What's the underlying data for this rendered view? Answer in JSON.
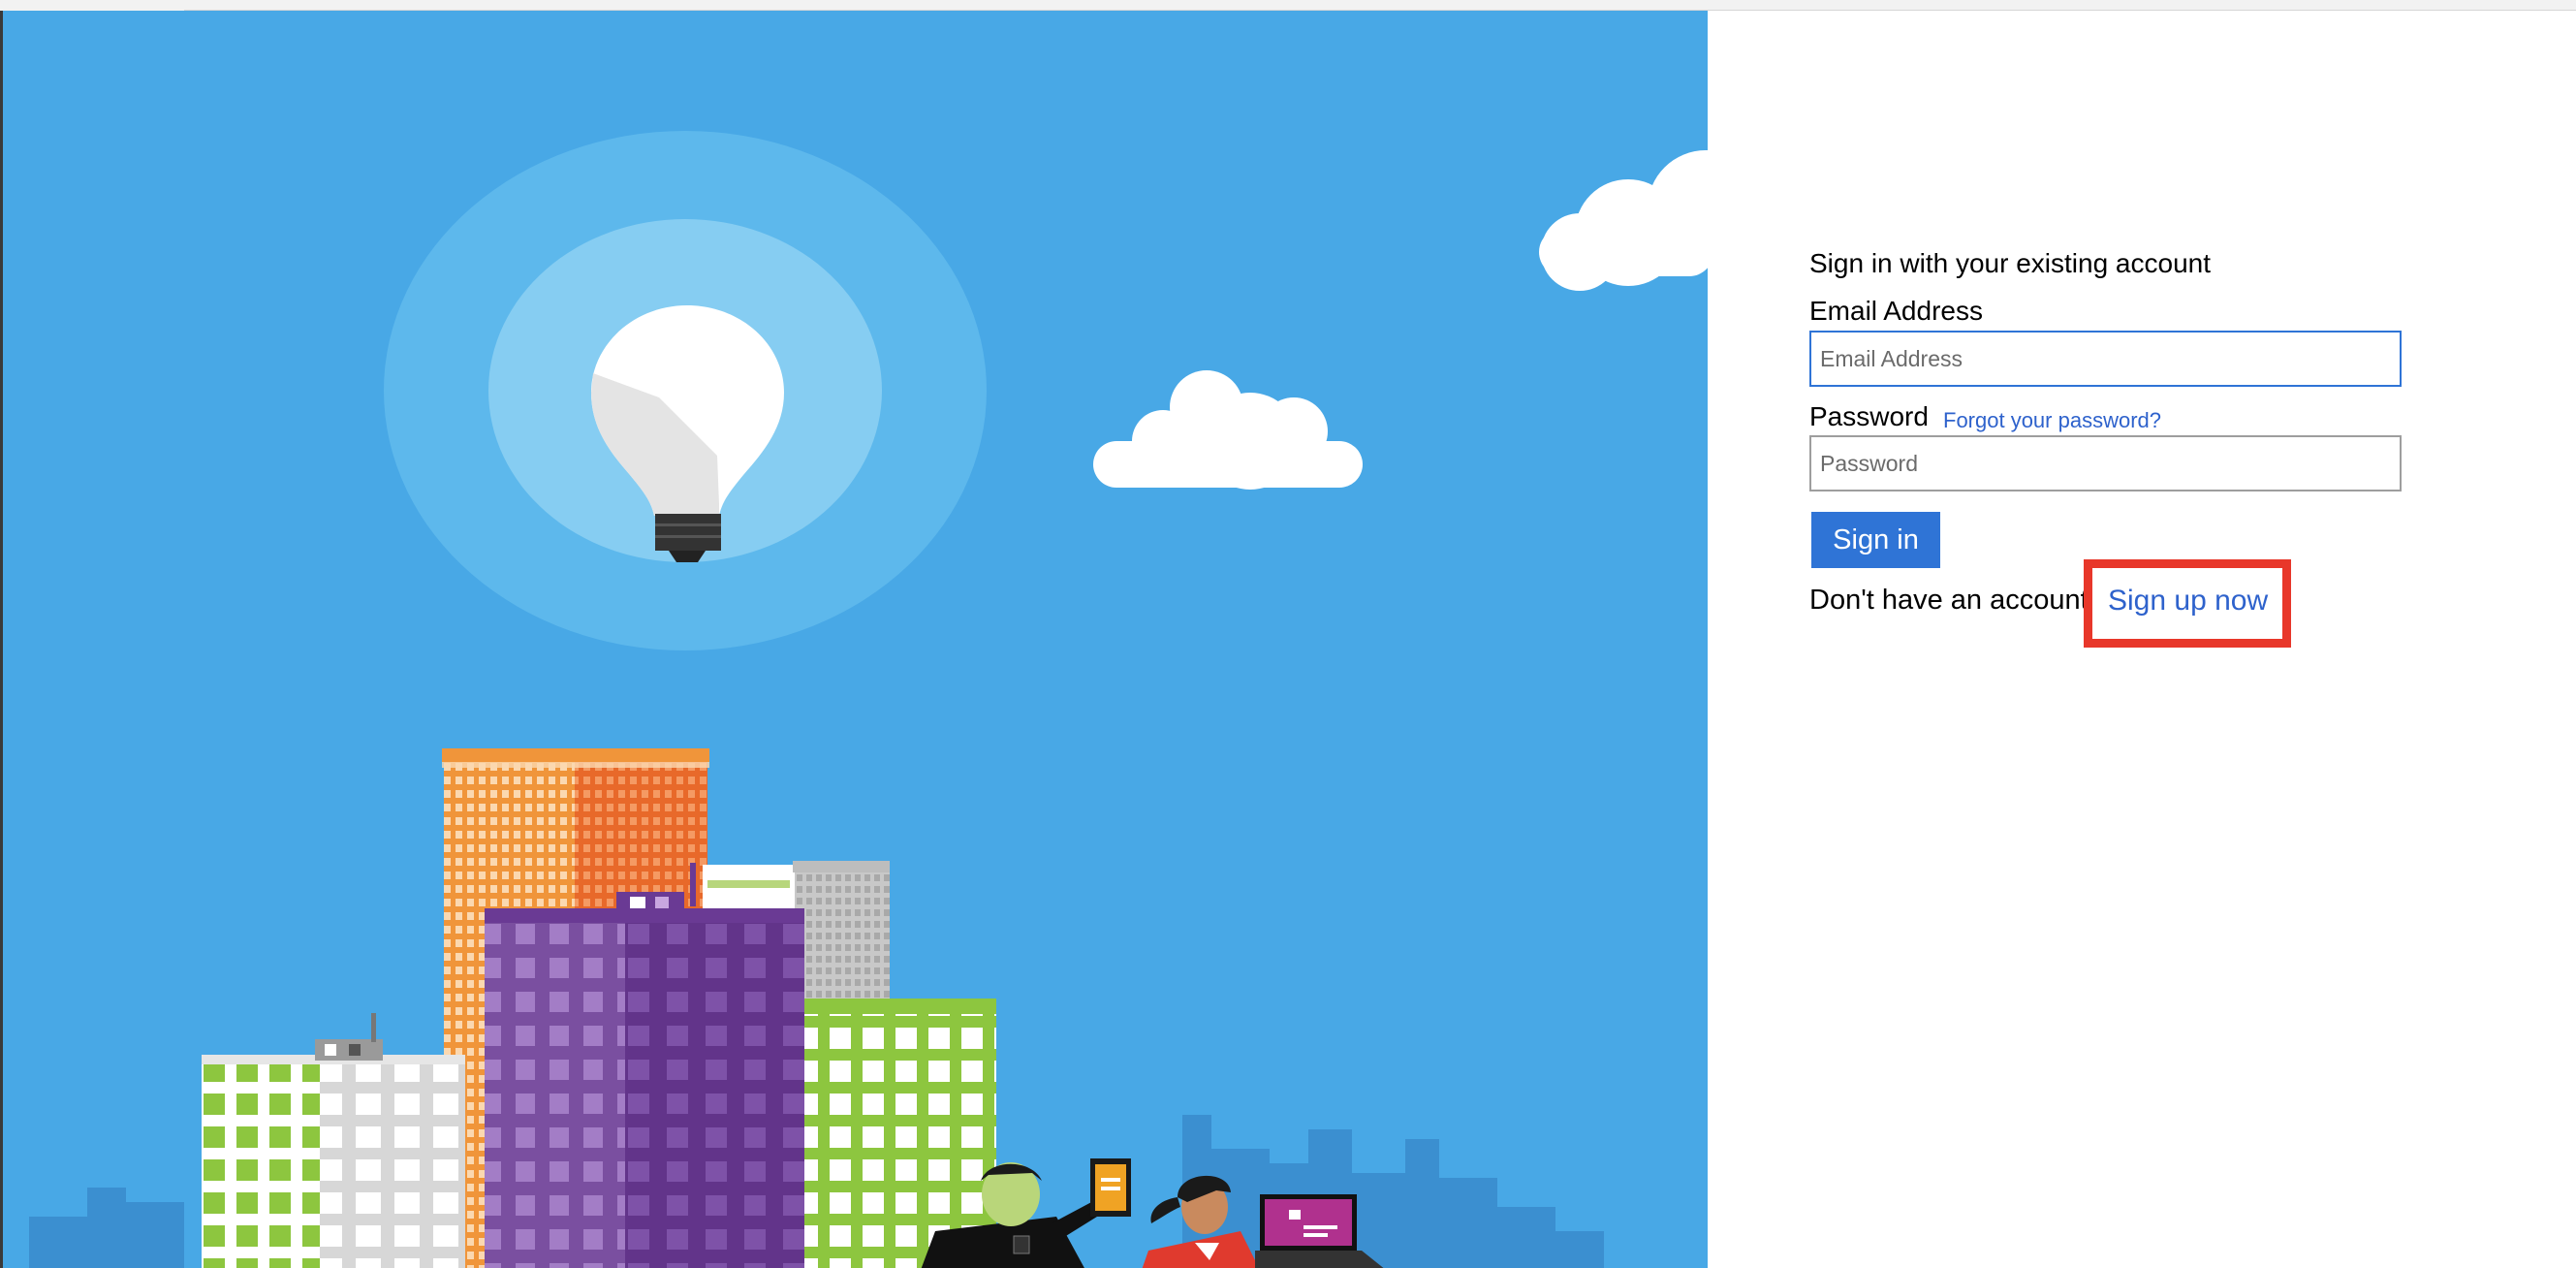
{
  "signin": {
    "heading": "Sign in with your existing account",
    "email_label": "Email Address",
    "email_placeholder": "Email Address",
    "email_value": "",
    "password_label": "Password",
    "password_placeholder": "Password",
    "password_value": "",
    "forgot_link": "Forgot your password?",
    "signin_button": "Sign in",
    "no_account_text": "Don't have an account?",
    "signup_link": "Sign up now"
  },
  "colors": {
    "sky": "#48a8e6",
    "primary_button": "#2f74d6",
    "link": "#2e62cc",
    "highlight": "#e8372a"
  },
  "icons": {
    "hero": "city-skyline-illustration",
    "bulb": "lightbulb-icon",
    "cloud": "cloud-icon"
  }
}
